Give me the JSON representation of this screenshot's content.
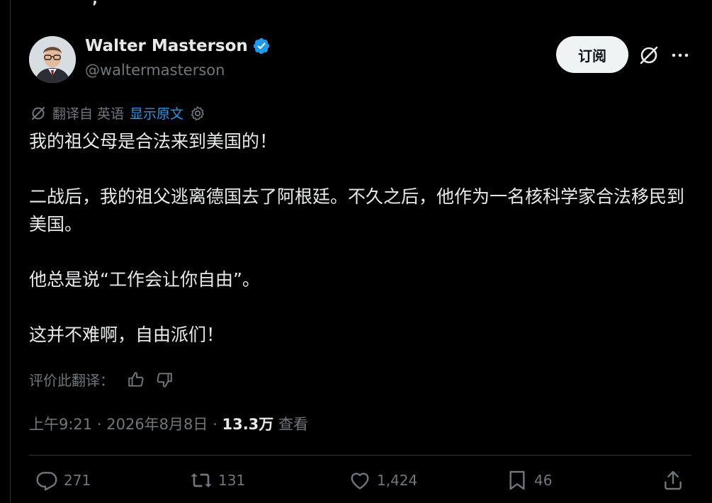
{
  "author": {
    "display_name": "Walter Masterson",
    "handle": "@waltermasterson"
  },
  "header_actions": {
    "subscribe_label": "订阅"
  },
  "translation": {
    "translated_from": "翻译自 英语",
    "show_original": "显示原文"
  },
  "tweet": {
    "paragraphs": [
      "我的祖父母是合法来到美国的！",
      "二战后，我的祖父逃离德国去了阿根廷。不久之后，他作为一名核科学家合法移民到美国。",
      "他总是说“工作会让你自由”。",
      "这并不难啊，自由派们！"
    ]
  },
  "rate_translation": {
    "label": "评价此翻译："
  },
  "meta": {
    "time": "上午9:21",
    "separator": "·",
    "date": "2026年8月8日",
    "views_count": "13.3万",
    "views_label": "查看"
  },
  "actions": {
    "replies": "271",
    "reposts": "131",
    "likes": "1,424",
    "bookmarks": "46"
  },
  "colors": {
    "background": "#000000",
    "text": "#e7e9ea",
    "muted": "#71767b",
    "accent": "#1d9bf0",
    "divider": "#2f3336"
  },
  "icons": [
    "verified-badge-icon",
    "grok-icon",
    "more-icon",
    "translate-icon",
    "settings-gear-icon",
    "thumbs-up-icon",
    "thumbs-down-icon",
    "reply-icon",
    "repost-icon",
    "like-icon",
    "bookmark-icon",
    "share-icon"
  ]
}
